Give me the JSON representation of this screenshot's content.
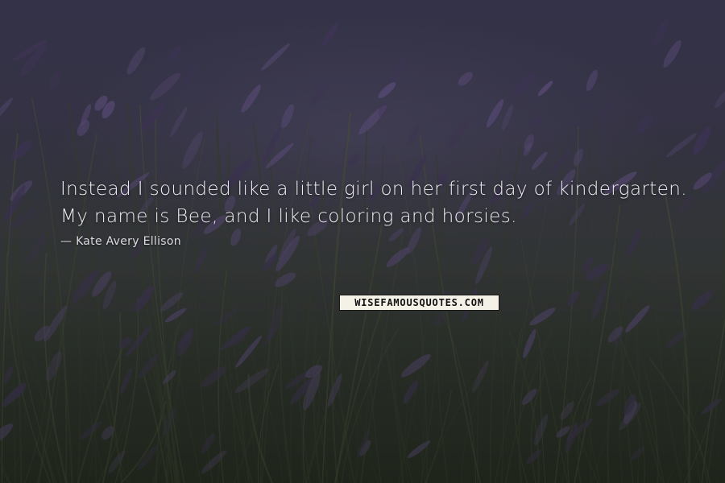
{
  "quote": {
    "text": "Instead I sounded like a little girl on her first day of kindergarten. My name is Bee, and I like coloring and horsies.",
    "author": "Kate Avery Ellison"
  },
  "brand": {
    "label": "WISEFAMOUSQUOTES.COM"
  },
  "colors": {
    "lavender": "#6b5a8e",
    "lavender_dark": "#4a3d66",
    "foliage": "#3d4a2e",
    "text": "#efedf2"
  }
}
